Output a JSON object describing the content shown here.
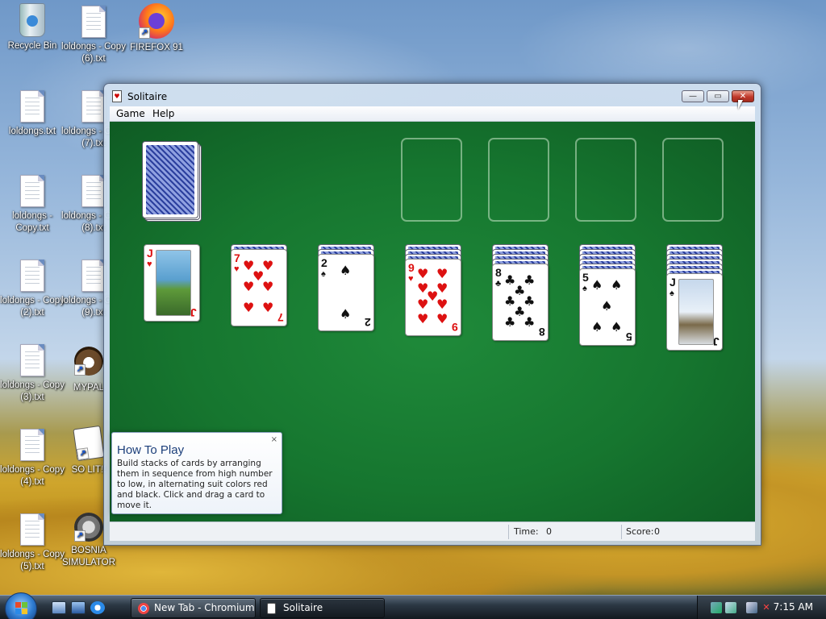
{
  "desktop": {
    "icons": [
      {
        "label": "Recycle Bin"
      },
      {
        "label": "loldongs - Copy (6).txt"
      },
      {
        "label": "FIREFOX 91"
      },
      {
        "label": "loldongs.txt"
      },
      {
        "label": "loldongs - Copy (7).txt"
      },
      {
        "label": "loldongs - Copy.txt"
      },
      {
        "label": "loldongs - Copy (8).txt"
      },
      {
        "label": "loldongs - Copy (2).txt"
      },
      {
        "label": "loldongs - Copy (9).txt"
      },
      {
        "label": "loldongs - Copy (3).txt"
      },
      {
        "label": "MYPAL"
      },
      {
        "label": "loldongs - Copy (4).txt"
      },
      {
        "label": "SO LIT!!"
      },
      {
        "label": "loldongs - Copy (5).txt"
      },
      {
        "label": "BOSNIA SIMULATOR"
      }
    ]
  },
  "window": {
    "title": "Solitaire",
    "minimize": "—",
    "maximize": "▭",
    "close": "✕"
  },
  "menubar": {
    "items": [
      "Game",
      "Help"
    ]
  },
  "game": {
    "tableau": [
      {
        "hidden": 0,
        "rank": "J",
        "suit": "♥",
        "color": "red"
      },
      {
        "hidden": 1,
        "rank": "7",
        "suit": "♥",
        "color": "red"
      },
      {
        "hidden": 2,
        "rank": "2",
        "suit": "♠",
        "color": "black"
      },
      {
        "hidden": 3,
        "rank": "9",
        "suit": "♥",
        "color": "red"
      },
      {
        "hidden": 4,
        "rank": "8",
        "suit": "♣",
        "color": "black"
      },
      {
        "hidden": 5,
        "rank": "5",
        "suit": "♠",
        "color": "black"
      },
      {
        "hidden": 6,
        "rank": "J",
        "suit": "♠",
        "color": "black"
      }
    ],
    "foundations": 4
  },
  "help_panel": {
    "title": "How To Play",
    "text": "Build stacks of cards by arranging them in sequence from high number to low, in alternating suit colors red and black. Click and drag a card to move it.",
    "close": "×"
  },
  "status": {
    "time_label": "Time:",
    "time_value": "0",
    "score_label": "Score:",
    "score_value": "0"
  },
  "taskbar": {
    "buttons": [
      {
        "label": "New Tab - Chromium"
      },
      {
        "label": "Solitaire"
      }
    ],
    "clock": "7:15 AM"
  },
  "colors": {
    "felt": "#16762f",
    "red_suit": "#d11111",
    "black_suit": "#111111"
  }
}
